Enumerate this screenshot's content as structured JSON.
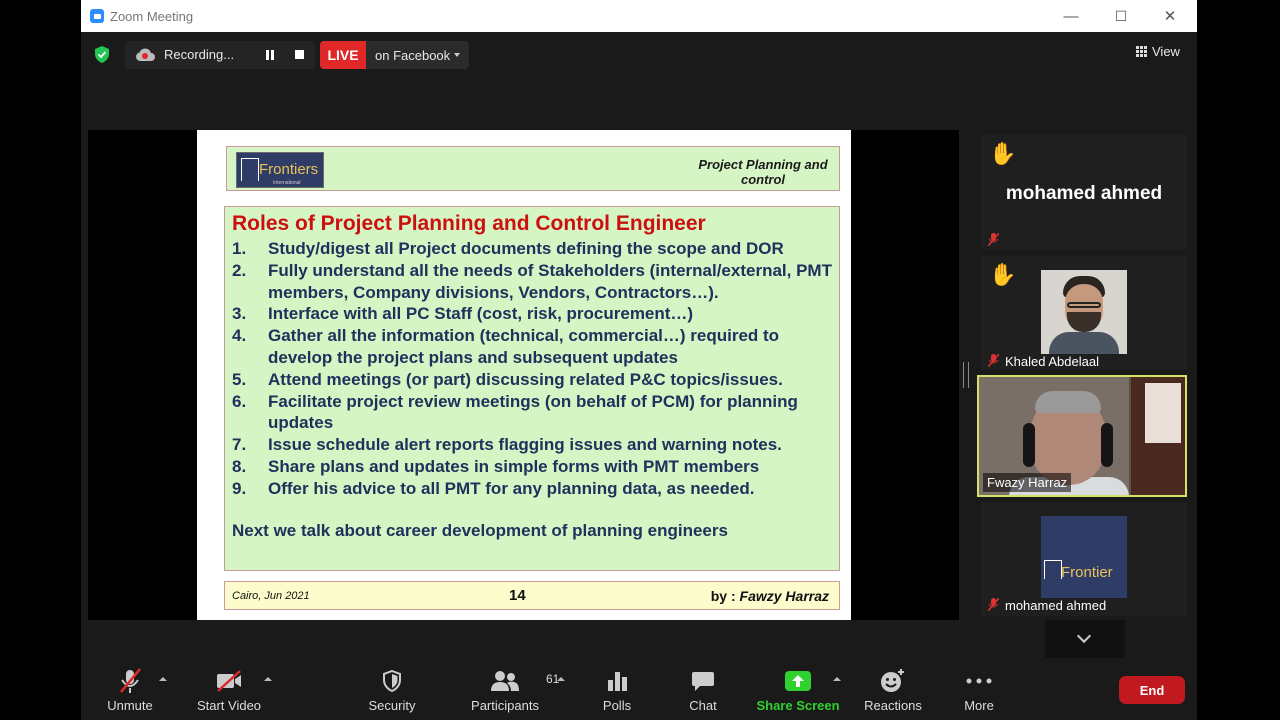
{
  "window": {
    "title": "Zoom Meeting",
    "minimize": "—",
    "maximize": "☐",
    "close": "✕"
  },
  "topbar": {
    "recording_label": "Recording...",
    "live_label": "LIVE",
    "stream_target": "on Facebook",
    "view_label": "View"
  },
  "slide": {
    "logo_text": "Frontiers",
    "logo_sub": "International",
    "header_title": "Project Planning and control",
    "title": "Roles of Project Planning and Control Engineer",
    "items": [
      {
        "n": "1.",
        "text": "Study/digest all Project documents defining the scope and DOR"
      },
      {
        "n": "2.",
        "text": "Fully understand all the needs of Stakeholders (internal/external, PMT members, Company divisions, Vendors, Contractors…)."
      },
      {
        "n": "3.",
        "text": "Interface with all PC Staff (cost, risk, procurement…)"
      },
      {
        "n": "4.",
        "text": "Gather all the information (technical, commercial…) required to develop the project plans and subsequent updates"
      },
      {
        "n": "5.",
        "text": "Attend meetings (or part) discussing related P&C topics/issues."
      },
      {
        "n": "6.",
        "text": "Facilitate project review meetings (on behalf of PCM) for planning updates"
      },
      {
        "n": "7.",
        "text": "Issue schedule alert reports flagging issues and warning notes."
      },
      {
        "n": "8.",
        "text": "Share plans and updates in simple forms with PMT members"
      },
      {
        "n": "9.",
        "text": "Offer his advice to all PMT for any planning data, as needed."
      }
    ],
    "next_line": "Next we talk about career development of planning engineers",
    "footer_left": "Cairo, Jun 2021",
    "footer_page": "14",
    "footer_by": "by : ",
    "footer_author": "Fawzy Harraz"
  },
  "participants": [
    {
      "name": "mohamed ahmed",
      "hand": "✋"
    },
    {
      "name": "Khaled Abdelaal",
      "hand": "✋"
    },
    {
      "name": "Fwazy Harraz"
    },
    {
      "name": "mohamed ahmed",
      "logo_text": "Frontier"
    }
  ],
  "toolbar": {
    "unmute": "Unmute",
    "start_video": "Start Video",
    "security": "Security",
    "participants": "Participants",
    "participants_count": "61",
    "polls": "Polls",
    "chat": "Chat",
    "share_screen": "Share Screen",
    "reactions": "Reactions",
    "more": "More",
    "end": "End"
  },
  "colors": {
    "share_green": "#2ed12e",
    "end_red": "#c0191f",
    "live_red": "#e02828",
    "active_speaker_border": "#d5e06b",
    "slide_title_red": "#cc1010",
    "slide_text_blue": "#22305c"
  }
}
